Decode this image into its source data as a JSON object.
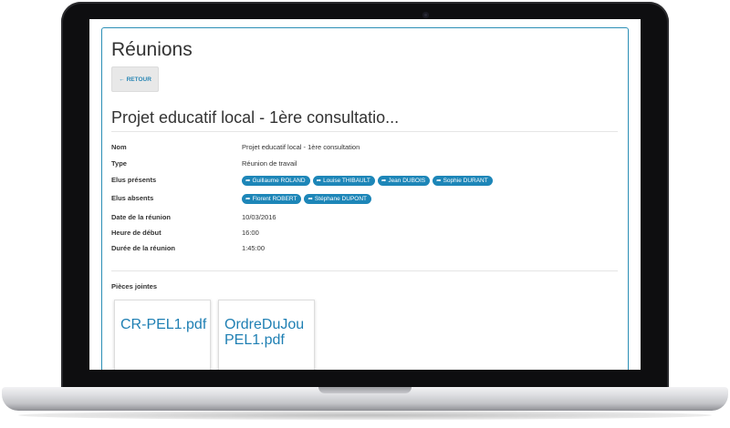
{
  "page": {
    "title": "Réunions",
    "back_button": "RETOUR",
    "meeting_title": "Projet educatif local - 1ère consultatio..."
  },
  "details": {
    "nom_label": "Nom",
    "nom_value": "Projet educatif local - 1ère consultation",
    "type_label": "Type",
    "type_value": "Réunion de travail",
    "elus_presents_label": "Elus présents",
    "elus_presents": [
      "Guillaume ROLAND",
      "Louise THIBAULT",
      "Jean DUBOIS",
      "Sophie DURANT"
    ],
    "elus_absents_label": "Elus absents",
    "elus_absents": [
      "Florent ROBERT",
      "Stéphane DUPONT"
    ],
    "date_label": "Date de la réunion",
    "date_value": "10/03/2016",
    "heure_label": "Heure de début",
    "heure_value": "16:00",
    "duree_label": "Durée de la réunion",
    "duree_value": "1:45:00"
  },
  "attachments": {
    "label": "Pièces jointes",
    "files": [
      "CR-PEL1.pdf",
      "OrdreDuJou\nPEL1.pdf"
    ]
  },
  "colors": {
    "accent": "#1d86b8",
    "panel_border": "#2c8fb6"
  },
  "icons": {
    "back": "arrow-left-icon",
    "person_link": "share-arrow-icon"
  }
}
